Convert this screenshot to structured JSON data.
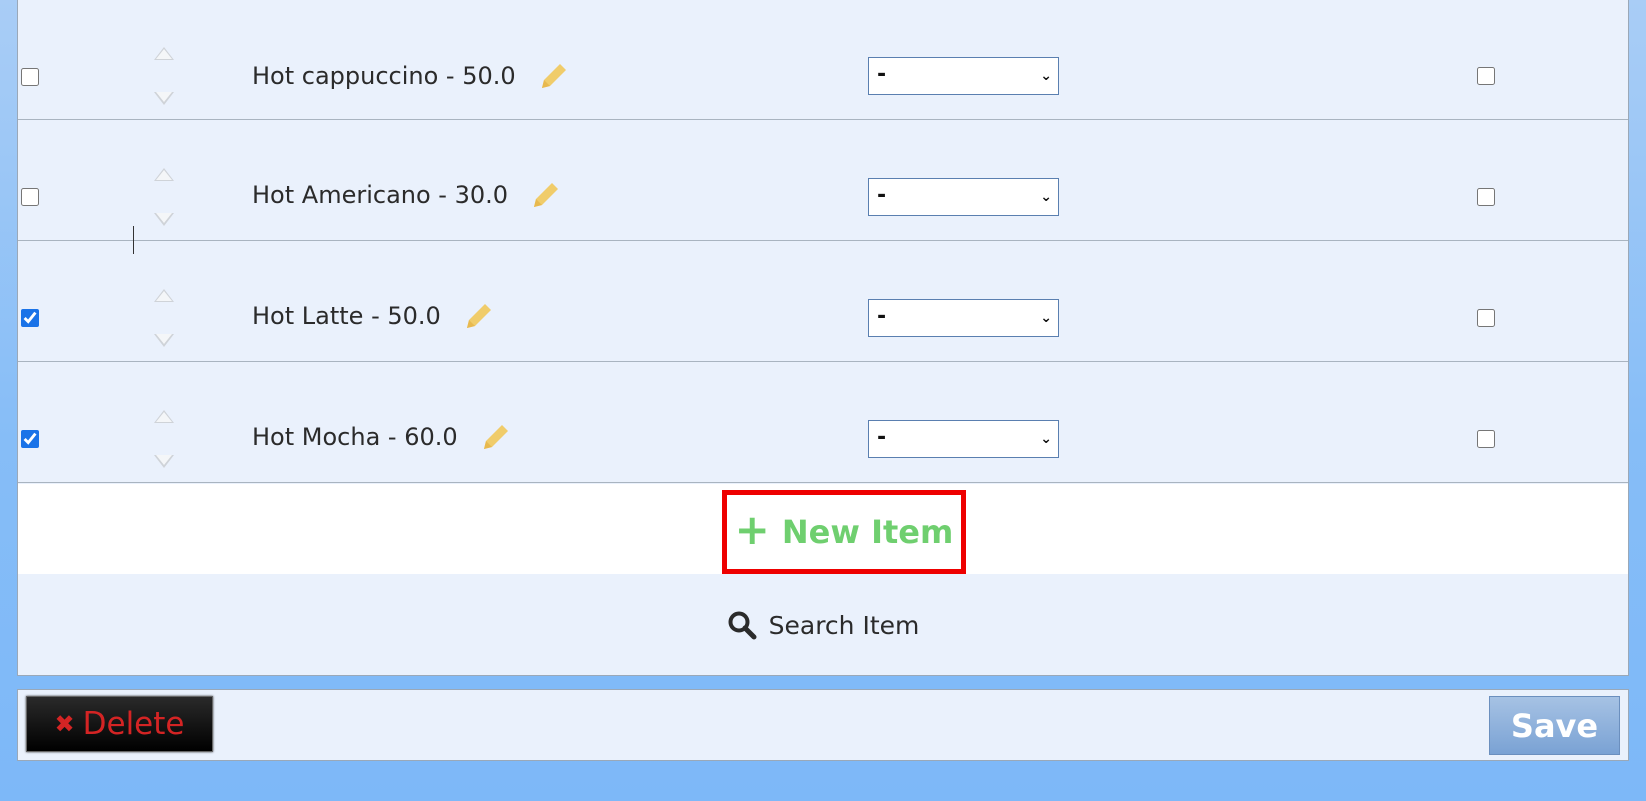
{
  "items": [
    {
      "label": "Hot cappuccino - 50.0",
      "checked": false,
      "select_value": "-",
      "right_checked": false
    },
    {
      "label": "Hot Americano - 30.0",
      "checked": false,
      "select_value": "-",
      "right_checked": false
    },
    {
      "label": "Hot Latte - 50.0",
      "checked": true,
      "select_value": "-",
      "right_checked": false
    },
    {
      "label": "Hot Mocha - 60.0",
      "checked": true,
      "select_value": "-",
      "right_checked": false
    }
  ],
  "new_item": {
    "label": "New Item",
    "icon": "plus-icon"
  },
  "search_item": {
    "label": "Search Item",
    "icon": "search-icon"
  },
  "footer": {
    "delete_label": "Delete",
    "save_label": "Save"
  },
  "colors": {
    "accent_green": "#6fcf6f",
    "highlight_red": "#ee0000",
    "delete_red": "#d42424",
    "pencil_yellow": "#f0cc6a"
  }
}
